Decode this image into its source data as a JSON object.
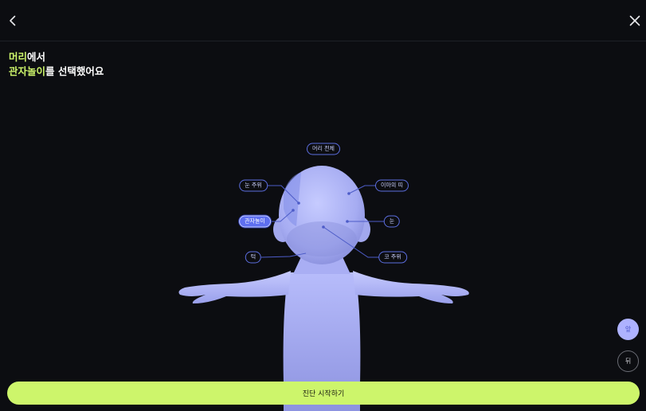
{
  "header": {
    "back_icon": "chevron-left-icon",
    "close_icon": "close-icon"
  },
  "selection": {
    "part": "머리",
    "part_suffix": "에서",
    "region": "관자놀이",
    "region_suffix": "를 선택했어요"
  },
  "body_labels": {
    "whole_head": "머리 전체",
    "around_eyes": "눈 주위",
    "forehead": "이마의 띠",
    "temple": "관자놀이",
    "eye": "눈",
    "jaw": "턱",
    "around_nose": "코 주위"
  },
  "view_toggle": {
    "front": "앞",
    "back": "뒤",
    "selected": "앞"
  },
  "cta": {
    "label": "진단 시작하기"
  },
  "colors": {
    "background": "#0c0d11",
    "accent": "#cdf56b",
    "figure": "#b3b8f8",
    "label_border": "#5c6ee0"
  }
}
